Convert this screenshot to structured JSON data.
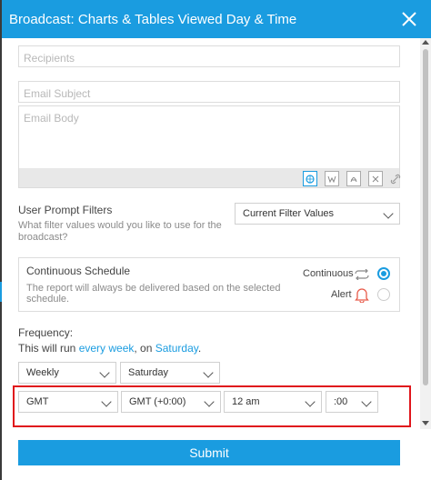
{
  "dialog": {
    "title": "Broadcast: Charts & Tables Viewed Day & Time"
  },
  "form": {
    "recipients_placeholder": "Recipients",
    "subject_placeholder": "Email Subject",
    "body_placeholder": "Email Body",
    "body_toolbar_icons": [
      "web-format-icon",
      "word-format-icon",
      "pdf-format-icon",
      "excel-format-icon",
      "link-icon"
    ]
  },
  "user_prompt": {
    "label": "User Prompt Filters",
    "description_line1": "What filter values would you like to use for the",
    "description_line2": "broadcast?",
    "selected": "Current Filter Values"
  },
  "schedule": {
    "title": "Continuous Schedule",
    "description_line1": "The report will always be delivered based on the selected",
    "description_line2": "schedule.",
    "continuous_label": "Continuous",
    "alert_label": "Alert",
    "selected": "Continuous"
  },
  "frequency": {
    "label": "Frequency:",
    "sentence_prefix": "This will run ",
    "period_link": "every week",
    "sentence_middle": ", on ",
    "day_link": "Saturday",
    "sentence_suffix": ".",
    "period_select": "Weekly",
    "day_select": "Saturday"
  },
  "time": {
    "timezone": "GMT",
    "offset": "GMT (+0:00)",
    "hour": "12 am",
    "minute": ":00"
  },
  "footer": {
    "submit_label": "Submit"
  },
  "colors": {
    "accent": "#1a9ce0",
    "highlight": "#e0161c",
    "alert_icon": "#e85b4a"
  }
}
